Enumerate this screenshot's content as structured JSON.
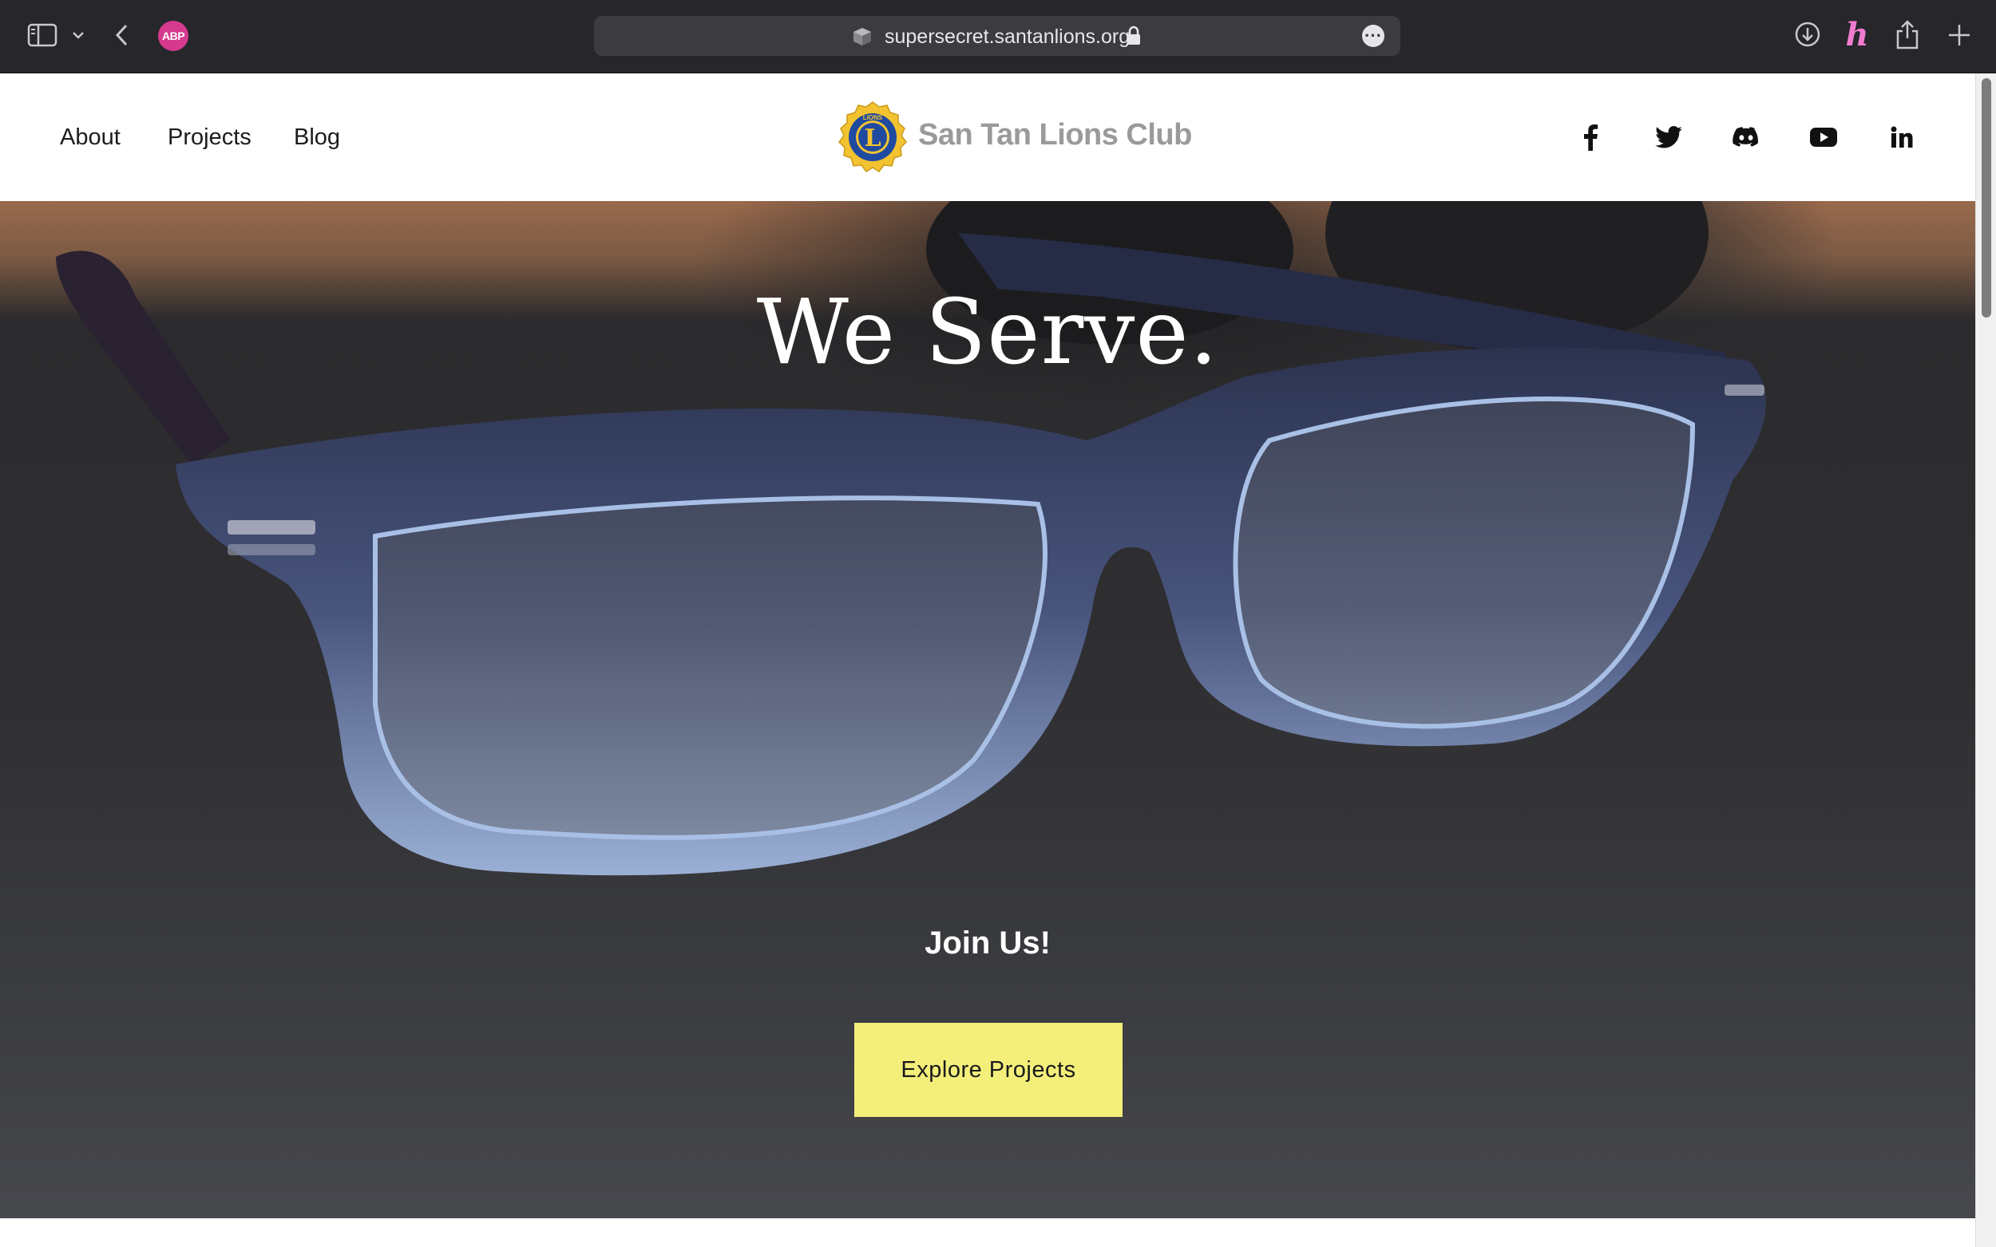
{
  "browser": {
    "url": "supersecret.santanlions.org",
    "extension_abp_label": "ABP",
    "icons": [
      "sidebar-icon",
      "chevron-down-icon",
      "back-arrow-icon",
      "adblock-icon",
      "cube-icon",
      "lock-icon",
      "more-icon",
      "download-icon",
      "honey-icon",
      "share-icon",
      "new-tab-plus-icon"
    ]
  },
  "header": {
    "nav": [
      {
        "label": "About"
      },
      {
        "label": "Projects"
      },
      {
        "label": "Blog"
      }
    ],
    "logo_text": "San Tan Lions Club",
    "logo_emblem_letters": "LIONS INTERNATIONAL L",
    "social": [
      "facebook-icon",
      "twitter-icon",
      "discord-icon",
      "youtube-icon",
      "linkedin-icon"
    ]
  },
  "hero": {
    "title": "We Serve.",
    "subtitle": "Join Us!",
    "button_label": "Explore Projects"
  },
  "colors": {
    "chrome_bg": "#26262b",
    "button_bg": "#f4ef7b",
    "logo_text": "#9a9a9a",
    "emblem_gold": "#f2c230",
    "emblem_blue": "#1f4aa0"
  }
}
